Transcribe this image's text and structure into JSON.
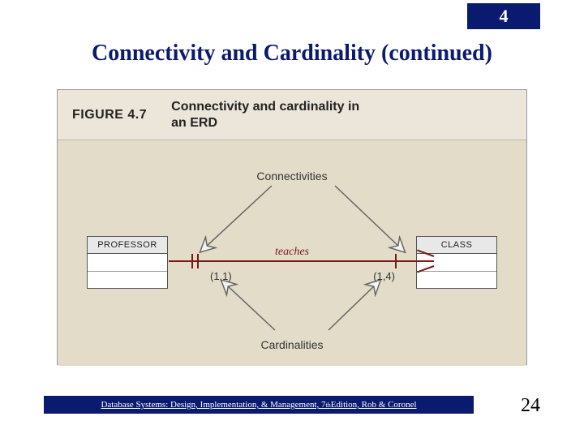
{
  "chapter": "4",
  "title": "Connectivity and Cardinality (continued)",
  "figure": {
    "number": "FIGURE 4.7",
    "caption_line1": "Connectivity and cardinality in",
    "caption_line2": "an ERD",
    "labels": {
      "top": "Connectivities",
      "bottom": "Cardinalities",
      "relationship": "teaches"
    },
    "entities": {
      "left": "PROFESSOR",
      "right": "CLASS"
    },
    "cardinalities": {
      "left": "(1,1)",
      "right": "(1,4)"
    }
  },
  "footer": {
    "text_prefix": "Database Systems: Design, Implementation, & Management, 7",
    "text_sup": "th",
    "text_suffix": " Edition, Rob & Coronel"
  },
  "page_number": "24"
}
